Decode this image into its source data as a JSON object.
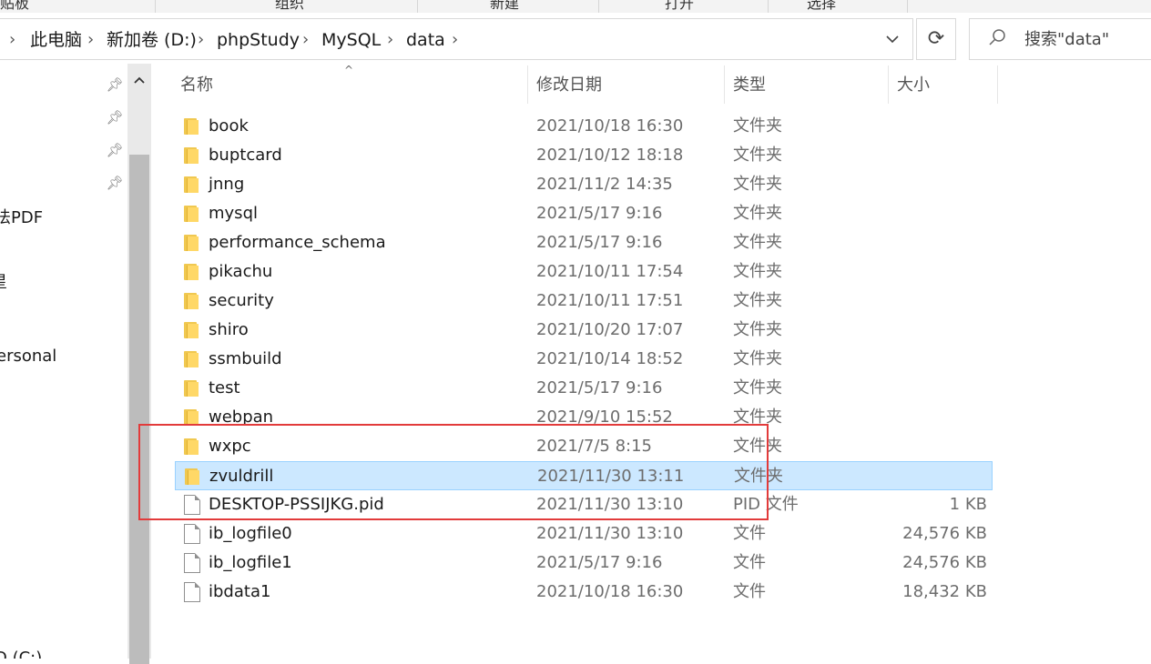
{
  "ribbon": {
    "groups": [
      "贴板",
      "组织",
      "新建",
      "打开",
      "选择"
    ]
  },
  "breadcrumb": {
    "items": [
      "此电脑",
      "新加卷 (D:)",
      "phpStudy",
      "MySQL",
      "data"
    ]
  },
  "search": {
    "placeholder": "搜索\"data\""
  },
  "nav": {
    "items": [
      "法PDF",
      "星",
      "ersonal",
      "D (C:)"
    ],
    "pins": 4
  },
  "columns": {
    "name": "名称",
    "date": "修改日期",
    "type": "类型",
    "size": "大小"
  },
  "files": [
    {
      "name": "book",
      "date": "2021/10/18 16:30",
      "type": "文件夹",
      "size": "",
      "icon": "folder-icon"
    },
    {
      "name": "buptcard",
      "date": "2021/10/12 18:18",
      "type": "文件夹",
      "size": "",
      "icon": "folder-icon"
    },
    {
      "name": "jnng",
      "date": "2021/11/2 14:35",
      "type": "文件夹",
      "size": "",
      "icon": "folder-icon"
    },
    {
      "name": "mysql",
      "date": "2021/5/17 9:16",
      "type": "文件夹",
      "size": "",
      "icon": "folder-icon"
    },
    {
      "name": "performance_schema",
      "date": "2021/5/17 9:16",
      "type": "文件夹",
      "size": "",
      "icon": "folder-icon"
    },
    {
      "name": "pikachu",
      "date": "2021/10/11 17:54",
      "type": "文件夹",
      "size": "",
      "icon": "folder-icon"
    },
    {
      "name": "security",
      "date": "2021/10/11 17:51",
      "type": "文件夹",
      "size": "",
      "icon": "folder-icon"
    },
    {
      "name": "shiro",
      "date": "2021/10/20 17:07",
      "type": "文件夹",
      "size": "",
      "icon": "folder-icon"
    },
    {
      "name": "ssmbuild",
      "date": "2021/10/14 18:52",
      "type": "文件夹",
      "size": "",
      "icon": "folder-icon"
    },
    {
      "name": "test",
      "date": "2021/5/17 9:16",
      "type": "文件夹",
      "size": "",
      "icon": "folder-icon"
    },
    {
      "name": "webpan",
      "date": "2021/9/10 15:52",
      "type": "文件夹",
      "size": "",
      "icon": "folder-icon"
    },
    {
      "name": "wxpc",
      "date": "2021/7/5 8:15",
      "type": "文件夹",
      "size": "",
      "icon": "folder-icon"
    },
    {
      "name": "zvuldrill",
      "date": "2021/11/30 13:11",
      "type": "文件夹",
      "size": "",
      "icon": "folder-icon",
      "selected": true
    },
    {
      "name": "DESKTOP-PSSIJKG.pid",
      "date": "2021/11/30 13:10",
      "type": "PID 文件",
      "size": "1 KB",
      "icon": "file-icon"
    },
    {
      "name": "ib_logfile0",
      "date": "2021/11/30 13:10",
      "type": "文件",
      "size": "24,576 KB",
      "icon": "file-icon"
    },
    {
      "name": "ib_logfile1",
      "date": "2021/5/17 9:16",
      "type": "文件",
      "size": "24,576 KB",
      "icon": "file-icon"
    },
    {
      "name": "ibdata1",
      "date": "2021/10/18 16:30",
      "type": "文件",
      "size": "18,432 KB",
      "icon": "file-icon"
    }
  ],
  "colors": {
    "selection": "#cce8ff",
    "selection_border": "#99d1ff",
    "highlight_box": "#e23b3b",
    "folder": "#ffd867"
  }
}
